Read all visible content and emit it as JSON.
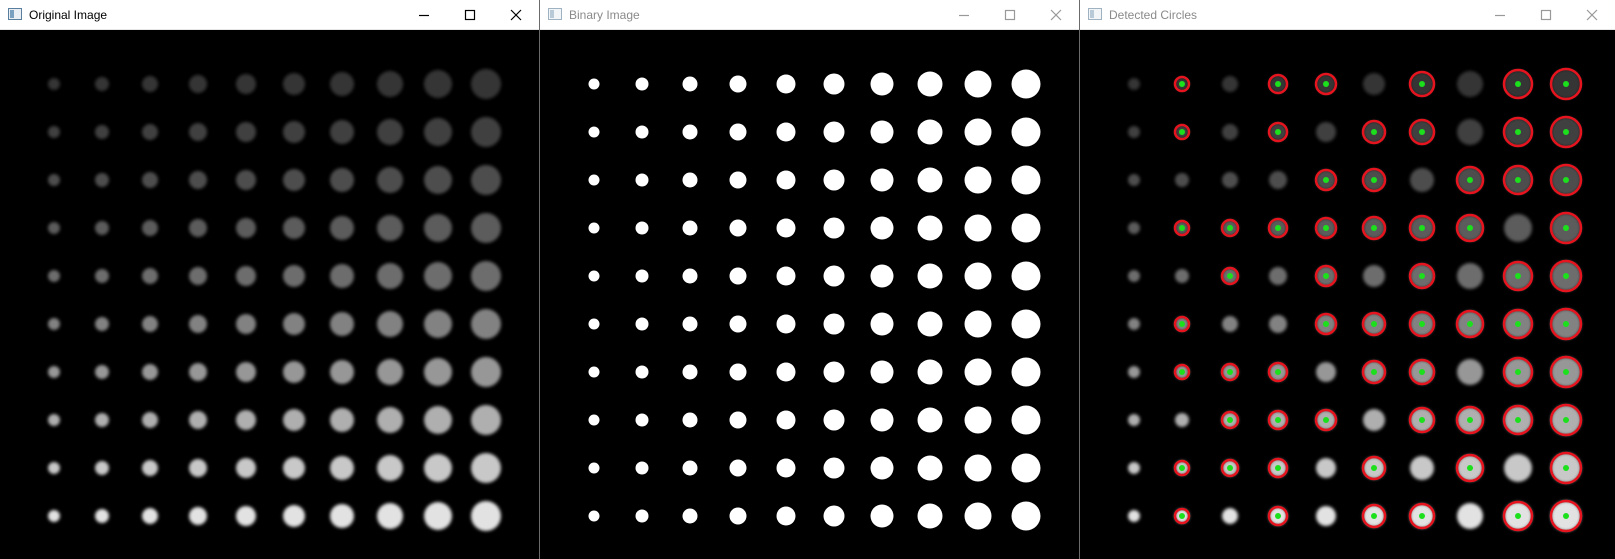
{
  "windows": [
    {
      "id": "w1",
      "title": "Original Image",
      "active": true
    },
    {
      "id": "w2",
      "title": "Binary Image",
      "active": false
    },
    {
      "id": "w3",
      "title": "Detected Circles",
      "active": false
    }
  ],
  "controls": {
    "minimize_icon": "minimize-icon",
    "maximize_icon": "maximize-icon",
    "close_icon": "close-icon"
  },
  "grid": {
    "rows": 10,
    "cols": 10,
    "radii": [
      6,
      7,
      8,
      9,
      10,
      11,
      12,
      13,
      14,
      15
    ],
    "row_gray": [
      "#353535",
      "#414141",
      "#4e4e4e",
      "#5b5b5b",
      "#6d6d6d",
      "#828282",
      "#979797",
      "#afafaf",
      "#c8c8c8",
      "#e2e2e2"
    ]
  },
  "detections": [
    [
      1,
      3,
      4,
      6,
      8,
      9
    ],
    [
      1,
      3,
      5,
      6,
      8,
      9
    ],
    [
      4,
      5,
      7,
      8,
      9
    ],
    [
      1,
      2,
      3,
      4,
      5,
      6,
      7,
      9
    ],
    [
      2,
      4,
      6,
      8,
      9
    ],
    [
      1,
      4,
      5,
      6,
      7,
      8,
      9
    ],
    [
      1,
      2,
      3,
      5,
      6,
      8,
      9
    ],
    [
      2,
      3,
      4,
      6,
      7,
      8,
      9
    ],
    [
      1,
      2,
      3,
      5,
      7,
      9
    ],
    [
      1,
      3,
      5,
      6,
      8,
      9
    ]
  ],
  "colors": {
    "detection_ring": "#e6141e",
    "detection_center": "#1de01d",
    "binary_dot": "#ffffff",
    "background": "#000000"
  }
}
